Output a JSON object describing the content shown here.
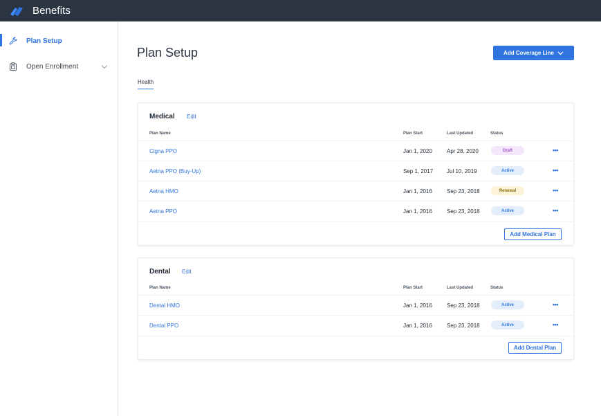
{
  "app": {
    "title": "Benefits"
  },
  "sidebar": {
    "items": [
      {
        "label": "Plan Setup",
        "icon": "wrench-icon",
        "active": true
      },
      {
        "label": "Open Enrollment",
        "icon": "clipboard-icon",
        "active": false,
        "expandable": true
      }
    ]
  },
  "main": {
    "title": "Plan Setup",
    "add_coverage_label": "Add Coverage Line",
    "tabs": [
      {
        "label": "Health",
        "active": true
      }
    ],
    "columns": {
      "plan_name": "Plan Name",
      "plan_start": "Plan Start",
      "last_updated": "Last Updated",
      "status": "Status"
    },
    "sections": [
      {
        "title": "Medical",
        "edit_label": "Edit",
        "add_label": "Add Medical Plan",
        "rows": [
          {
            "name": "Cigna PPO",
            "start": "Jan 1, 2020",
            "updated": "Apr 28, 2020",
            "status": "Draft"
          },
          {
            "name": "Aetna PPO (Buy-Up)",
            "start": "Sep 1, 2017",
            "updated": "Jul 10, 2019",
            "status": "Active"
          },
          {
            "name": "Aetna HMO",
            "start": "Jan 1, 2016",
            "updated": "Sep 23, 2018",
            "status": "Renewal"
          },
          {
            "name": "Aetna PPO",
            "start": "Jan 1, 2016",
            "updated": "Sep 23, 2018",
            "status": "Active"
          }
        ]
      },
      {
        "title": "Dental",
        "edit_label": "Edit",
        "add_label": "Add Dental Plan",
        "rows": [
          {
            "name": "Dental HMO",
            "start": "Jan 1, 2016",
            "updated": "Sep 23, 2018",
            "status": "Active"
          },
          {
            "name": "Dental PPO",
            "start": "Jan 1, 2016",
            "updated": "Sep 23, 2018",
            "status": "Active"
          }
        ]
      }
    ],
    "more_glyph": "•••"
  },
  "colors": {
    "topbar": "#2b3542",
    "accent": "#2f74e0",
    "draft_badge": "#f4e6fb",
    "active_badge": "#e4eefb",
    "renewal_badge": "#fdf3d6"
  }
}
